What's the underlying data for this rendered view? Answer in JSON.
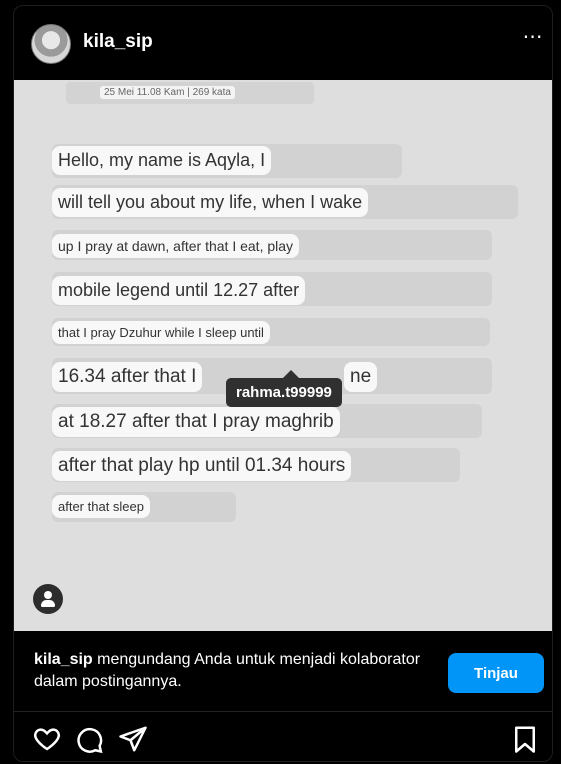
{
  "header": {
    "username": "kila_sip",
    "more_icon": "⋯"
  },
  "post": {
    "timestamp": "25 Mei 11.08 Kam | 269 kata",
    "lines": [
      "Hello, my name is Aqyla, I",
      "will tell you about my life, when I wake",
      "up I pray at dawn, after that I eat, play",
      "mobile legend until 12.27 after",
      "that I pray Dzuhur while I sleep until",
      "16.34 after that I",
      "ne",
      "at 18.27 after that I pray maghrib",
      "after that play hp until 01.34 hours",
      "after that sleep"
    ],
    "tagged_user": "rahma.t99999"
  },
  "invite": {
    "username": "kila_sip",
    "message": " mengundang Anda untuk menjadi kolaborator dalam postingannya.",
    "button_label": "Tinjau"
  },
  "colors": {
    "accent": "#0095f6",
    "background": "#000000",
    "media_bg": "#dedede"
  },
  "icons": [
    "heart-icon",
    "comment-icon",
    "share-icon",
    "bookmark-icon",
    "user-tag-icon",
    "avatar"
  ]
}
